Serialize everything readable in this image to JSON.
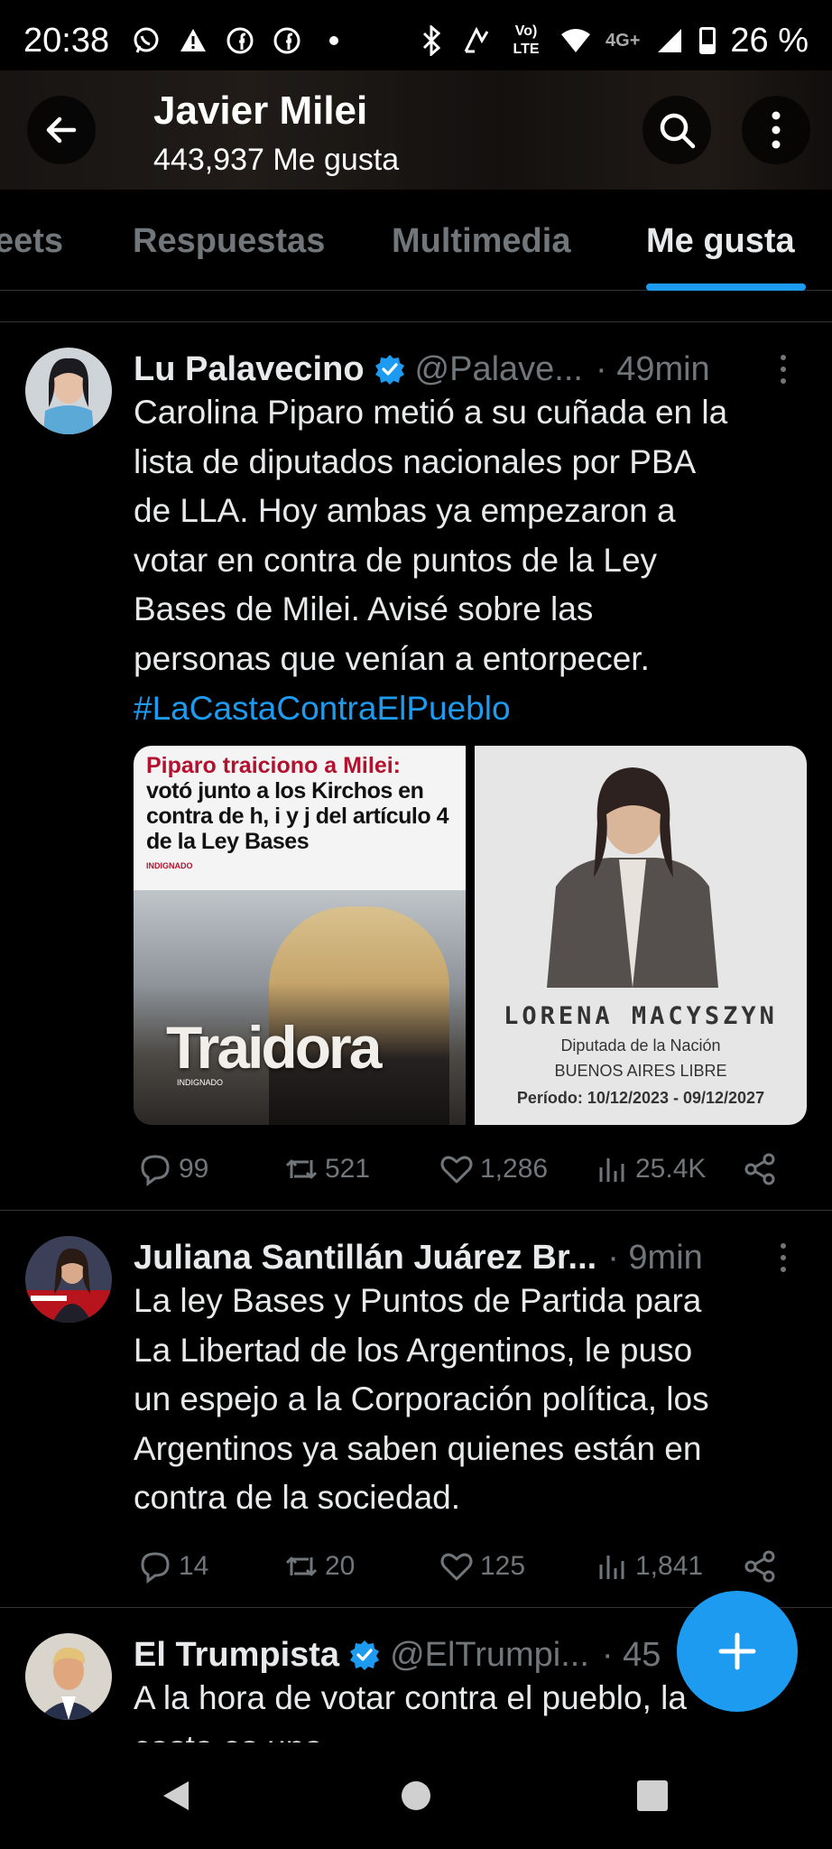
{
  "status_bar": {
    "time": "20:38",
    "network_label": "Vo) LTE",
    "signal_label": "4G+",
    "battery": "26 %",
    "icons_left": [
      "whatsapp-icon",
      "warning-icon",
      "facebook-icon",
      "facebook-icon",
      "dot-icon"
    ],
    "icons_right": [
      "bluetooth-icon",
      "nfc-icon",
      "volte-icon",
      "wifi-icon",
      "signal-icon",
      "battery-icon"
    ]
  },
  "header": {
    "title": "Javier Milei",
    "subtitle": "443,937 Me gusta"
  },
  "tabs": [
    {
      "label": "eets",
      "active": false
    },
    {
      "label": "Respuestas",
      "active": false
    },
    {
      "label": "Multimedia",
      "active": false
    },
    {
      "label": "Me gusta",
      "active": true
    }
  ],
  "tweets": [
    {
      "name": "Lu Palavecino",
      "verified": true,
      "handle": "@Palave...",
      "time": "· 49min",
      "text_lines": [
        "Carolina Piparo metió a su cuñada en la",
        "lista de diputados nacionales por PBA",
        "de LLA. Hoy ambas ya empezaron a",
        "votar en contra de puntos de la Ley",
        "Bases de Milei. Avisé sobre las",
        "personas que venían a entorpecer."
      ],
      "hashtag": "#LaCastaContraElPueblo",
      "media_left": {
        "headline": "Piparo traiciono a Milei:",
        "sub": "votó junto a los Kirchos en contra de h, i y j del artículo 4 de la Ley Bases",
        "brand": "INDIGNADO",
        "big_word": "Traidora",
        "brand2": "INDIGNADO"
      },
      "media_right": {
        "name": "LORENA MACYSZYN",
        "role": "Diputada de la Nación",
        "party": "BUENOS AIRES LIBRE",
        "period": "Período: 10/12/2023 - 09/12/2027"
      },
      "replies": "99",
      "retweets": "521",
      "likes": "1,286",
      "views": "25.4K"
    },
    {
      "name": "Juliana Santillán Juárez Br...",
      "verified": false,
      "handle": "",
      "time": "· 9min",
      "text_lines": [
        "La ley Bases y Puntos de Partida para",
        "La Libertad de los Argentinos, le puso",
        "un espejo a la Corporación política, los",
        "Argentinos ya saben quienes están en",
        "contra de la sociedad."
      ],
      "replies": "14",
      "retweets": "20",
      "likes": "125",
      "views": "1,841"
    },
    {
      "name": "El Trumpista",
      "verified": true,
      "handle": "@ElTrumpi...",
      "time": "· 45",
      "text_lines": [
        "A la hora de votar contra el pueblo, la",
        "casta es una"
      ]
    }
  ],
  "colors": {
    "accent": "#1d9bf0",
    "background": "#000000",
    "text_primary": "#e7e9ea",
    "text_secondary": "#71767b",
    "divider": "#2f3336"
  }
}
